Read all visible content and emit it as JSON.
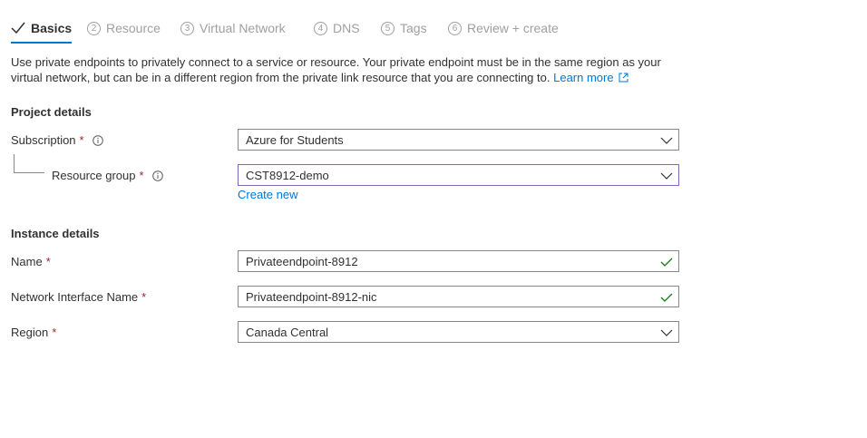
{
  "tabs": [
    {
      "number": "",
      "label": "Basics"
    },
    {
      "number": "2",
      "label": "Resource"
    },
    {
      "number": "3",
      "label": "Virtual Network"
    },
    {
      "number": "4",
      "label": "DNS"
    },
    {
      "number": "5",
      "label": "Tags"
    },
    {
      "number": "6",
      "label": "Review + create"
    }
  ],
  "intro": {
    "text": "Use private endpoints to privately connect to a service or resource. Your private endpoint must be in the same region as your virtual network, but can be in a different region from the private link resource that you are connecting to.",
    "learn_more": "Learn more"
  },
  "project_details": {
    "heading": "Project details",
    "subscription": {
      "label": "Subscription",
      "required": "*",
      "value": "Azure for Students"
    },
    "resource_group": {
      "label": "Resource group",
      "required": "*",
      "value": "CST8912-demo",
      "create_new": "Create new"
    }
  },
  "instance_details": {
    "heading": "Instance details",
    "name": {
      "label": "Name",
      "required": "*",
      "value": "Privateendpoint-8912"
    },
    "nic_name": {
      "label": "Network Interface Name",
      "required": "*",
      "value": "Privateendpoint-8912-nic"
    },
    "region": {
      "label": "Region",
      "required": "*",
      "value": "Canada Central"
    }
  },
  "colors": {
    "accent": "#0078d4",
    "valid": "#107c10",
    "required": "#a4262c",
    "focus": "#8764b8"
  }
}
